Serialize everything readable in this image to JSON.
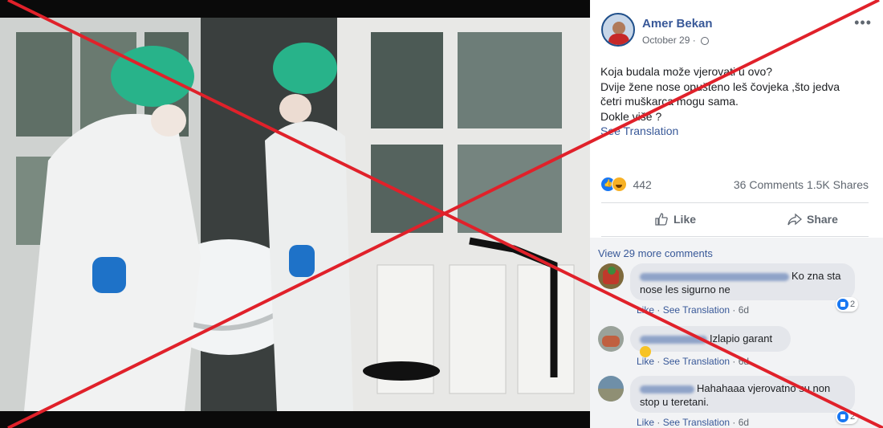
{
  "post": {
    "author": "Amer Bekan",
    "date": "October 29",
    "separator": "·",
    "more_label": "•••",
    "text_lines": [
      "Koja budala može vjerovati u ovo?",
      "Dvije žene nose opušteno leš čovjeka ,što jedva",
      "četri muškarca mogu sama.",
      "Dokle više ?"
    ],
    "see_translation": "See Translation",
    "reaction_count": "442",
    "comments_count": "36 Comments",
    "shares_count": "1.5K Shares",
    "like_label": "Like",
    "share_label": "Share"
  },
  "comments_section": {
    "view_more": "View 29 more comments",
    "comments": [
      {
        "text_line1": "Ko zna sta",
        "text_line2": "nose les sigurno ne",
        "like": "Like",
        "see_translation": "See Translation",
        "time": "6d",
        "reactions": "2"
      },
      {
        "text_line1": "Izlapio garant",
        "like": "Like",
        "see_translation": "See Translation",
        "time": "6d"
      },
      {
        "text_line1": "Hahahaaa vjerovatno su non",
        "text_line2": "stop u teretani.",
        "like": "Like",
        "see_translation": "See Translation",
        "time": "6d",
        "reactions": "2"
      }
    ]
  },
  "colors": {
    "link_blue": "#385898",
    "like_blue": "#1877f2",
    "cross_red": "#e0212a"
  }
}
